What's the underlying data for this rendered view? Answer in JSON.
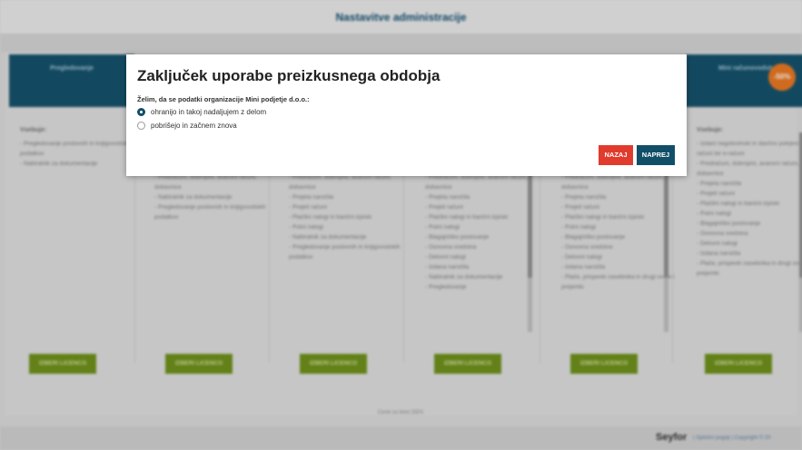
{
  "header": {
    "title": "Nastavitve administracije"
  },
  "background": {
    "contains_label": "Vsebuje:",
    "columns": [
      {
        "header": "Pregledovanje",
        "items": [
          "Pregledovanje poslovnih in knjigovodskih podatkov",
          "Nabiralnik za dokumentacije"
        ]
      },
      {
        "header": "",
        "items": [
          "Predračuni, dobropisi, avansni računi, dobavnice",
          "Nabiralnik za dokumentacije",
          "Pregledovanje poslovnih in knjigovodskih podatkov"
        ]
      },
      {
        "header": "",
        "items": [
          "Predračuni, dobropisi, avansni računi, dobavnice",
          "Prejeta naročila",
          "Prejeti računi",
          "Plačilni nalogi in bančni izpiski",
          "Potni nalogi",
          "Nabiralnik za dokumentacije",
          "Pregledovanje poslovnih in knjigovodskih podatkov"
        ]
      },
      {
        "header": "",
        "items": [
          "Predračuni, dobropisi, avansni računi, dobavnice",
          "Prejeta naročila",
          "Prejeti računi",
          "Plačilni nalogi in bančni izpiski",
          "Potni nalogi",
          "Blagajniško poslovanje",
          "Osnovna sredstva",
          "Delovni nalogi",
          "Izdana naročila",
          "Nabiralnik za dokumentacije",
          "Pregledovanje"
        ]
      },
      {
        "header": "",
        "items": [
          "Predračuni, dobropisi, avansni računi, dobavnice",
          "Prejeta naročila",
          "Prejeti računi",
          "Plačilni nalogi in bančni izpiski",
          "Potni nalogi",
          "Blagajniško poslovanje",
          "Osnovna sredstva",
          "Delovni nalogi",
          "Izdana naročila",
          "Plače, prispevki zasebnika in drugi osebni prejemki"
        ]
      },
      {
        "header": "Mini računovodstvo",
        "items": [
          "Izdani negotovinski in davčno potrjeni računi ter e-računi",
          "Predračuni, dobropisi, avansni računi, dobavnice",
          "Prejeta naročila",
          "Prejeti računi",
          "Plačilni nalogi in bančni izpiski",
          "Potni nalogi",
          "Blagajniško poslovanje",
          "Osnovna sredstva",
          "Delovni nalogi",
          "Izdana naročila",
          "Plače, prispevki zasebnika in drugi osebni prejemki"
        ]
      }
    ],
    "license_button_label": "IZBERI LICENCO",
    "discount_badge": "-50%",
    "footer_note": "Cene so brez DDV.",
    "brand": "Seyfor",
    "footer_links": "| Splošni pogoji | Copyright © 20"
  },
  "modal": {
    "title": "Zaključek uporabe preizkusnega obdobja",
    "prompt": "Želim, da se podatki organizacije Mini podjetje d.o.o.:",
    "options": [
      {
        "label": "ohranijo in takoj nadaljujem z delom",
        "checked": true
      },
      {
        "label": "pobrišejo in začnem znova",
        "checked": false
      }
    ],
    "back_label": "NAZAJ",
    "next_label": "NAPREJ"
  },
  "colors": {
    "primary": "#114e68",
    "danger": "#e13b2d",
    "license_green": "#6b8e16",
    "badge_orange": "#e8741e"
  }
}
